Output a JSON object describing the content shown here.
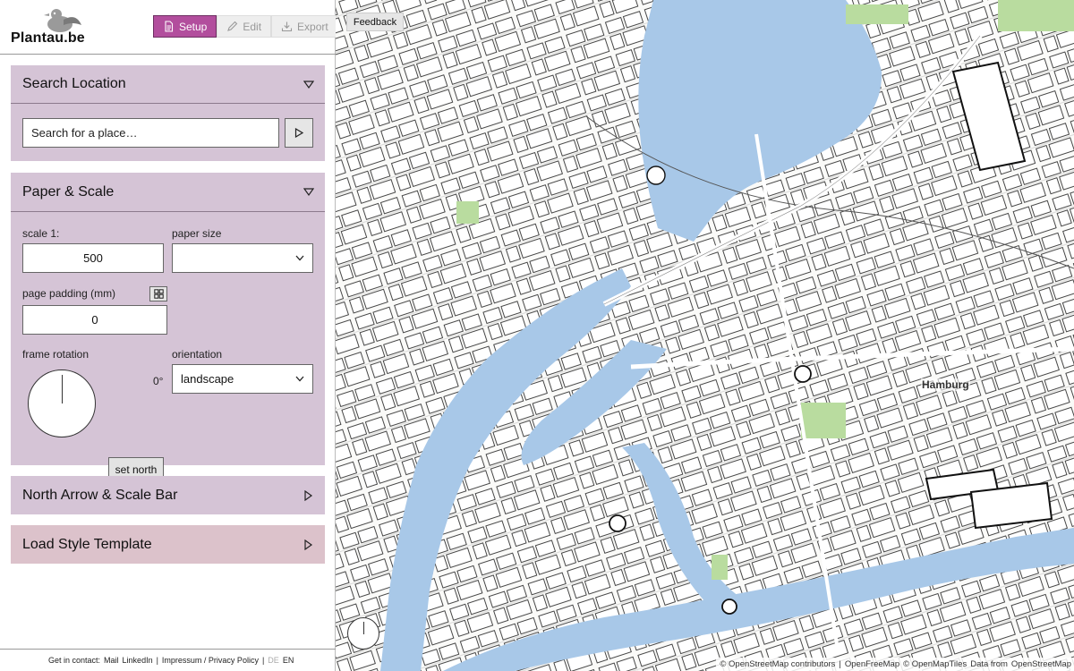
{
  "app": {
    "logo_text": "Plantau.be",
    "modes": [
      {
        "label": "Setup",
        "icon": "document-icon",
        "active": true
      },
      {
        "label": "Edit",
        "icon": "pencil-icon",
        "active": false
      },
      {
        "label": "Export",
        "icon": "download-icon",
        "active": false
      }
    ]
  },
  "panels": {
    "search": {
      "title": "Search Location",
      "input_value": "Search for a place…"
    },
    "paper": {
      "title": "Paper & Scale",
      "scale_label": "scale 1:",
      "scale_value": "500",
      "paper_size_label": "paper size",
      "paper_size_value": "",
      "padding_label": "page padding (mm)",
      "padding_value": "0",
      "rotation_label": "frame rotation",
      "rotation_value": "0°",
      "set_north_label": "set north",
      "orientation_label": "orientation",
      "orientation_value": "landscape"
    },
    "north": {
      "title": "North Arrow & Scale Bar"
    },
    "style": {
      "title": "Load Style Template"
    }
  },
  "footer": {
    "contact": "Get in contact:",
    "mail": "Mail",
    "linkedin": "LinkedIn",
    "sep": "|",
    "impressum": "Impressum / Privacy Policy",
    "lang_de": "DE",
    "lang_en": "EN"
  },
  "map": {
    "feedback_label": "Feedback",
    "city_label": "Hamburg",
    "attribution": [
      "© OpenStreetMap contributors",
      "|",
      "OpenFreeMap",
      "© OpenMapTiles",
      "Data from",
      "OpenStreetMap"
    ]
  },
  "colors": {
    "accent": "#b24e9d",
    "panel": "#d5c4d6",
    "panel_alt": "#dcc2cb",
    "water": "#a8c8e8",
    "park": "#b9dc9f"
  }
}
